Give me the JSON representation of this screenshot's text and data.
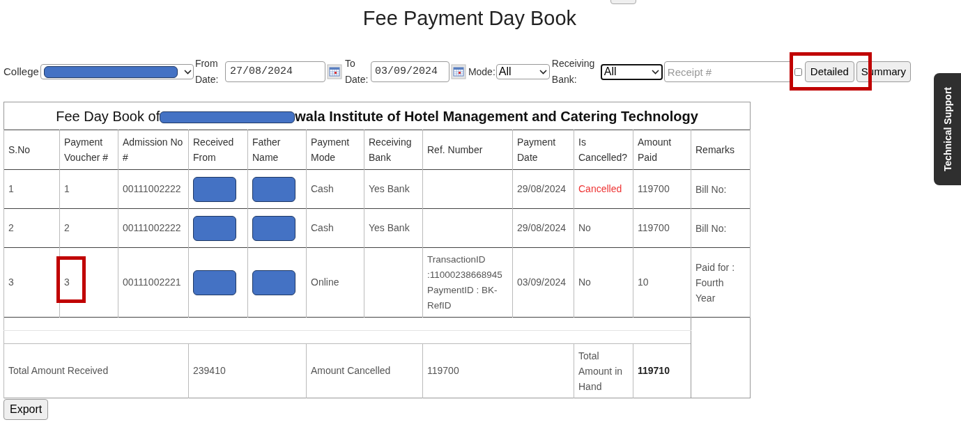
{
  "page_title": "Fee Payment Day Book",
  "filters": {
    "college_label": "College",
    "from_label": "From Date:",
    "from_value": "27/08/2024",
    "to_label": "To Date:",
    "to_value": "03/09/2024",
    "mode_label": "Mode:",
    "mode_value": "All",
    "bank_label": "Receiving Bank:",
    "bank_value": "All",
    "receipt_placeholder": "Receipt #",
    "detailed_checked": false
  },
  "buttons": [
    {
      "label": "Detailed",
      "kind": "detailed"
    },
    {
      "label": "Summary",
      "kind": "summary"
    }
  ],
  "buttons_highlighted": true,
  "table": {
    "title_prefix": "Fee Day Book of",
    "title_rest": "wala Institute of Hotel Management and Catering Technology",
    "columns": [
      "S.No",
      "Payment Voucher #",
      "Admission No #",
      "Received From",
      "Father Name",
      "Payment Mode",
      "Receiving Bank",
      "Ref. Number",
      "Payment Date",
      "Is Cancelled?",
      "Amount Paid",
      "Remarks"
    ],
    "rows": [
      {
        "sno": "1",
        "voucher": "1",
        "admission": "00111002222",
        "received_from_redacted": true,
        "father_redacted": true,
        "mode": "Cash",
        "bank": "Yes Bank",
        "ref": "",
        "date": "29/08/2024",
        "cancelled": true,
        "cancelled_text": "Cancelled",
        "amount": "119700",
        "remarks": "Bill No:",
        "highlighted": false
      },
      {
        "sno": "2",
        "voucher": "2",
        "admission": "00111002222",
        "received_from_redacted": true,
        "father_redacted": true,
        "mode": "Cash",
        "bank": "Yes Bank",
        "ref": "",
        "date": "29/08/2024",
        "cancelled": false,
        "cancelled_text": "No",
        "amount": "119700",
        "remarks": "Bill No:",
        "highlighted": false
      },
      {
        "sno": "3",
        "voucher": "3",
        "admission": "00111002221",
        "received_from_redacted": true,
        "father_redacted": true,
        "mode": "Online",
        "bank": "",
        "ref": "TransactionID :11000238668945 PaymentID : BK-RefID",
        "date": "03/09/2024",
        "cancelled": false,
        "cancelled_text": "No",
        "amount": "10",
        "remarks": "Paid for : Fourth Year",
        "highlighted": true
      }
    ],
    "totals": {
      "received_label": "Total Amount Received",
      "received": "239410",
      "cancelled_label": "Amount Cancelled",
      "cancelled": "119700",
      "in_hand_label": "Total Amount in Hand",
      "in_hand": "119710"
    }
  },
  "export_button": "Export",
  "side_tab": "Technical Support"
}
